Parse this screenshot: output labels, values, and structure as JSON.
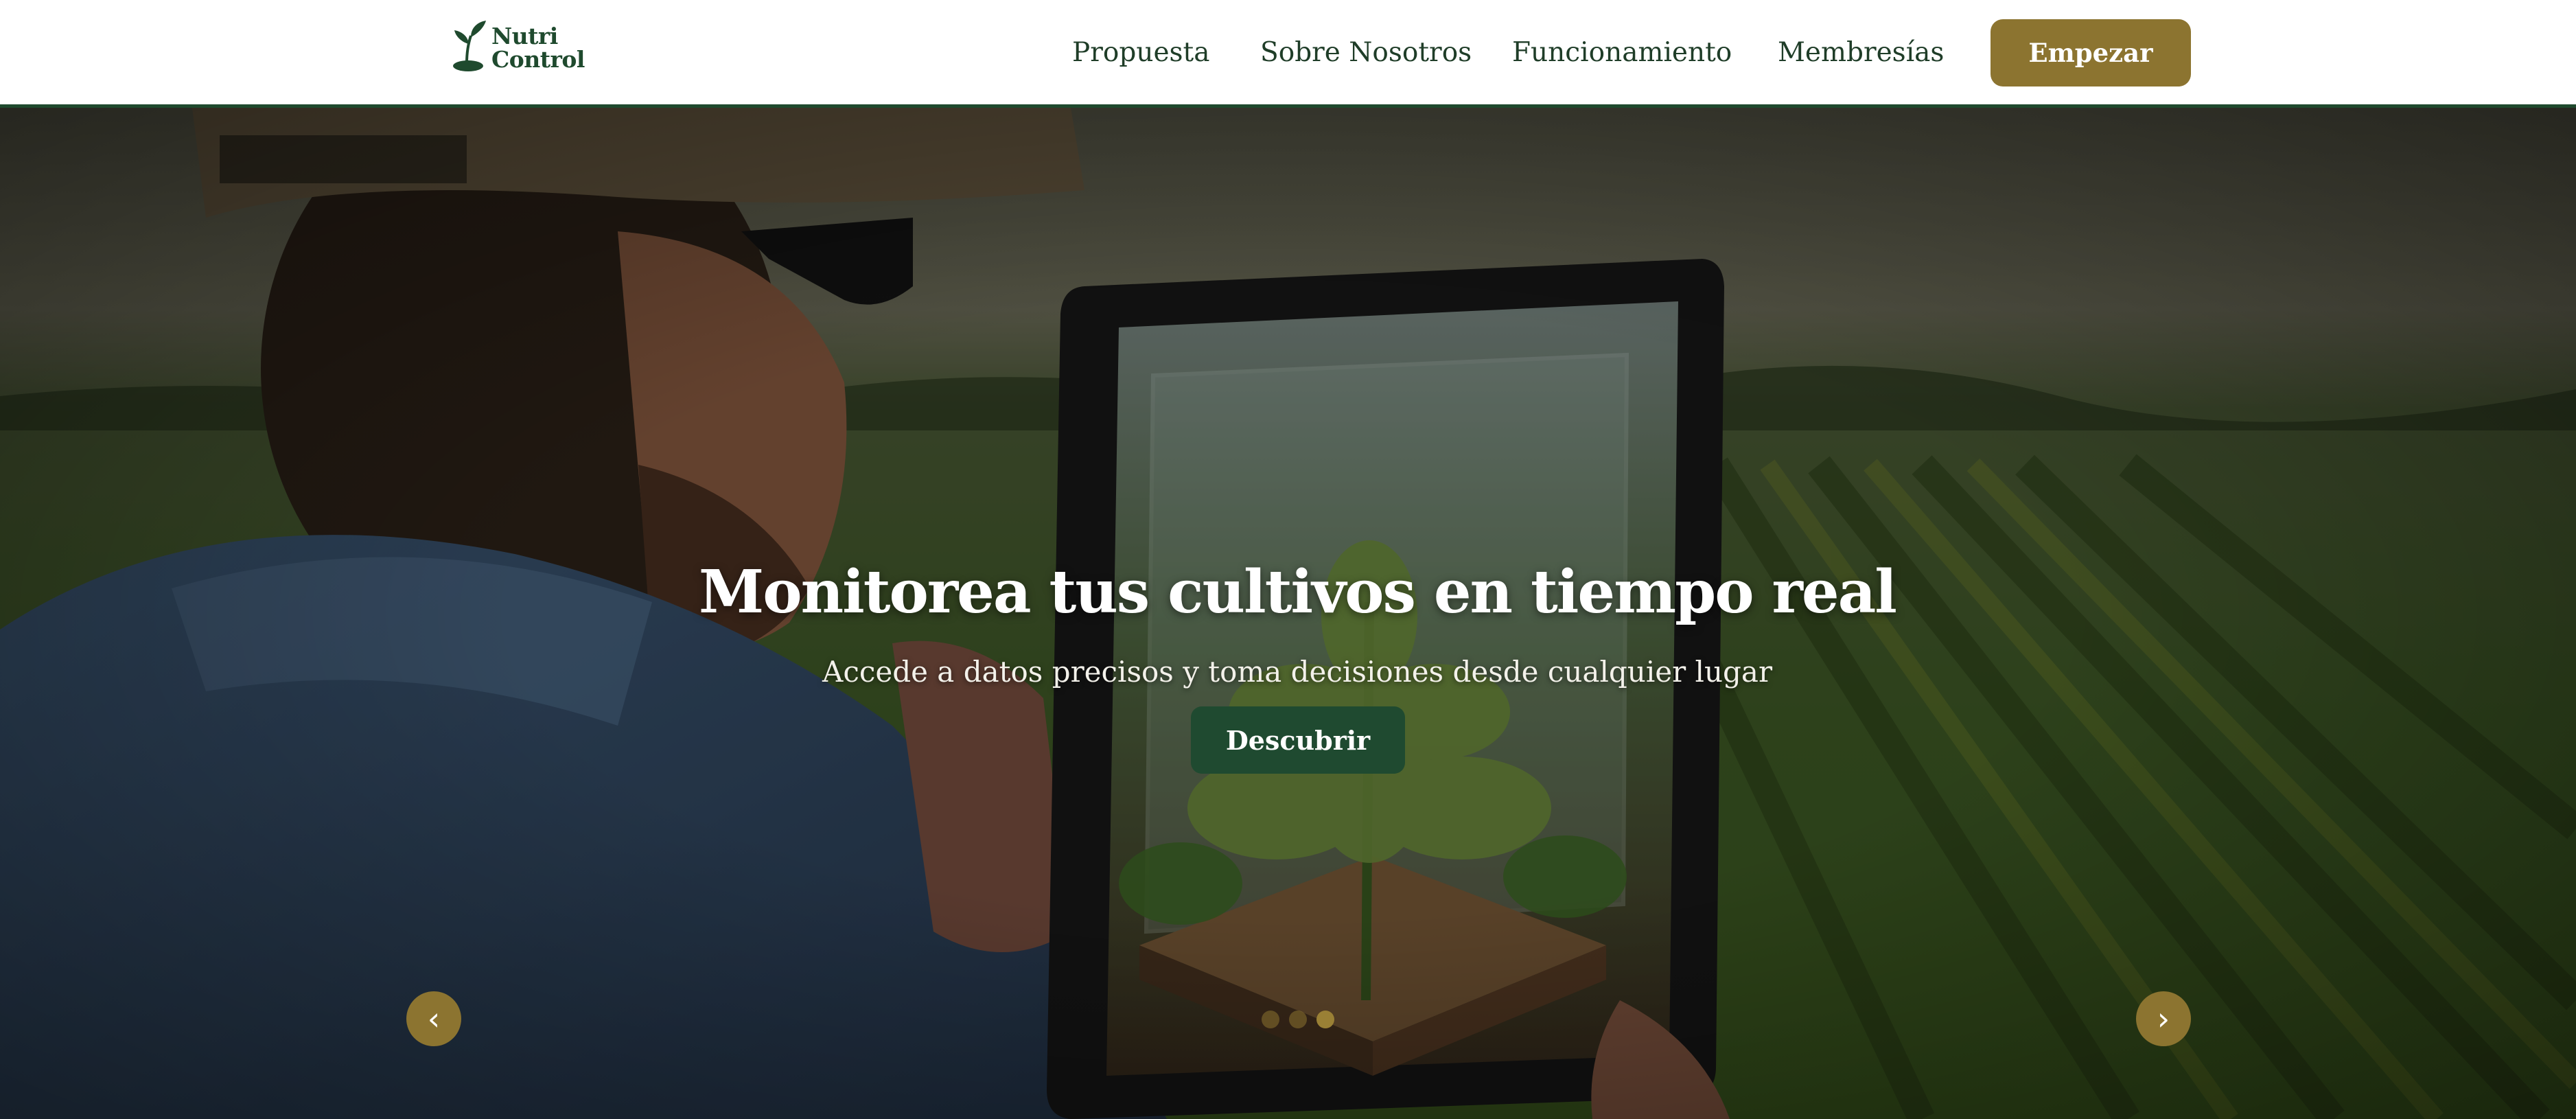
{
  "header": {
    "logo": {
      "line1": "Nutri",
      "line2": "Control"
    },
    "nav": [
      {
        "label": "Propuesta"
      },
      {
        "label": "Sobre Nosotros"
      },
      {
        "label": "Funcionamiento"
      },
      {
        "label": "Membresías"
      }
    ],
    "cta_label": "Empezar"
  },
  "hero": {
    "title": "Monitorea tus cultivos en tiempo real",
    "subtitle": "Accede a datos precisos y toma decisiones desde cualquier lugar",
    "button_label": "Descubrir",
    "prev_arrow": "‹",
    "next_arrow": "›",
    "slides_total": 3,
    "active_slide": 3
  },
  "colors": {
    "brand_green": "#1f4a2e",
    "accent_gold": "#8c7430",
    "white": "#ffffff"
  },
  "icons": {
    "logo": "sprout-icon",
    "prev": "chevron-left-icon",
    "next": "chevron-right-icon"
  }
}
